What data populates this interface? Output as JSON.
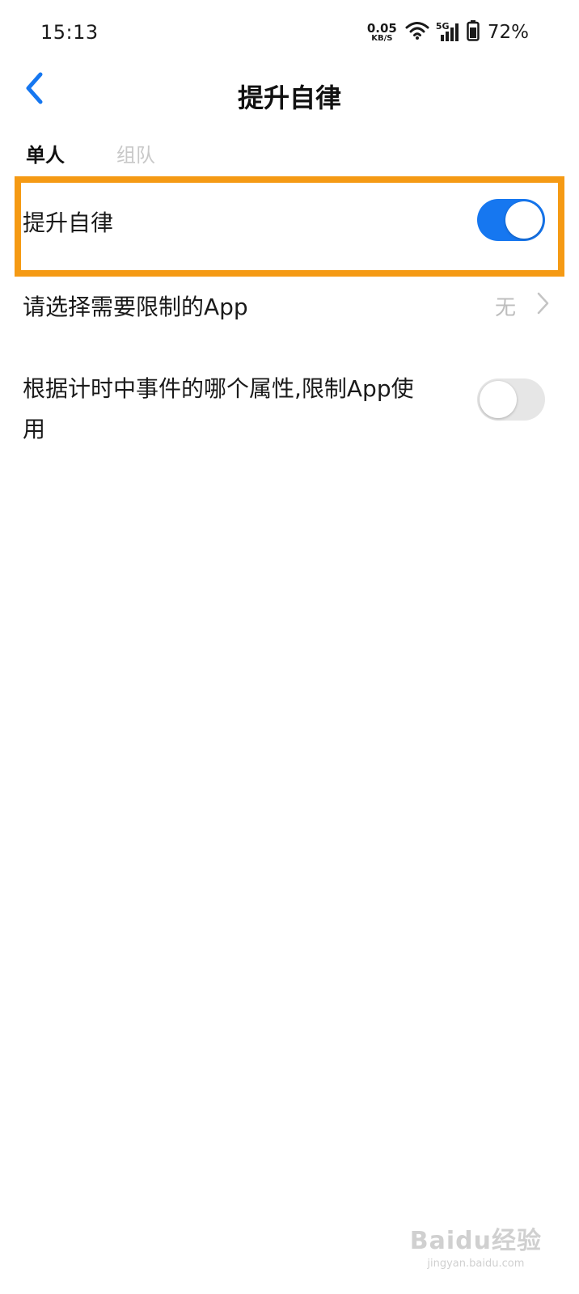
{
  "status_bar": {
    "time": "15:13",
    "net_speed_value": "0.05",
    "net_speed_unit": "KB/S",
    "network_type": "5G",
    "battery_percent": "72%",
    "icons": [
      "wifi-icon",
      "signal-icon",
      "battery-icon"
    ]
  },
  "header": {
    "title": "提升自律",
    "back_icon": "chevron-left-icon"
  },
  "tabs": [
    {
      "label": "单人",
      "active": true
    },
    {
      "label": "组队",
      "active": false
    }
  ],
  "settings": {
    "self_discipline": {
      "label": "提升自律",
      "enabled": true
    },
    "restricted_apps": {
      "label": "请选择需要限制的App",
      "value": "无"
    },
    "restrict_by_attribute": {
      "label_line1": "根据计时中事件的哪个属性,限制App使",
      "label_line2": "用",
      "enabled": false
    }
  },
  "colors": {
    "accent": "#1677f0",
    "highlight": "#f59a14",
    "toggle_off": "#e6e6e6",
    "muted_text": "#bdbdbd"
  },
  "watermark": {
    "brand": "Baidu经验",
    "url": "jingyan.baidu.com"
  }
}
